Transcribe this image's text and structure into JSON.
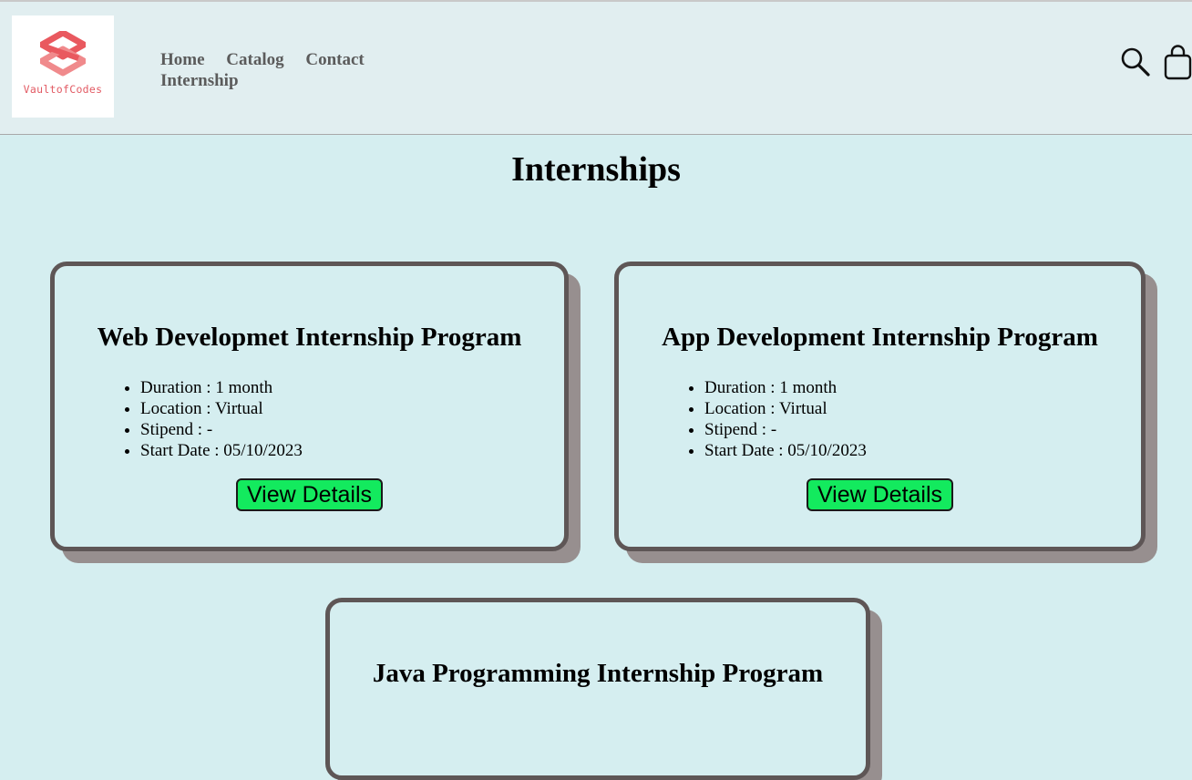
{
  "brand": {
    "logo_text": "VaultofCodes",
    "logo_color": "#e25a63"
  },
  "nav": {
    "items": [
      "Home",
      "Catalog",
      "Contact",
      "Internship"
    ]
  },
  "header_icons": [
    "search-icon",
    "shopping-bag-icon"
  ],
  "page": {
    "title": "Internships"
  },
  "cards": [
    {
      "title": "Web Developmet Internship Program",
      "details": [
        "Duration : 1 month",
        "Location : Virtual",
        "Stipend : -",
        "Start Date : 05/10/2023"
      ],
      "button": "View Details"
    },
    {
      "title": "App Development Internship Program",
      "details": [
        "Duration : 1 month",
        "Location : Virtual",
        "Stipend : -",
        "Start Date : 05/10/2023"
      ],
      "button": "View Details"
    },
    {
      "title": "Java Programming Internship Program"
    }
  ],
  "colors": {
    "page_background": "#d5eef0",
    "header_background": "#e1eef0",
    "card_border": "#5e5656",
    "card_shadow": "#978f8f",
    "button_background": "#13ea5e"
  }
}
